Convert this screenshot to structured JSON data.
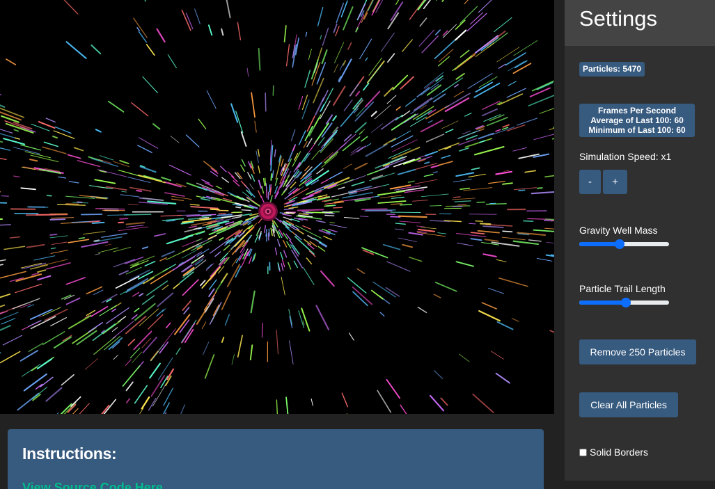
{
  "instructions": {
    "title": "Instructions:",
    "link_label": "View Source Code Here"
  },
  "settings": {
    "title": "Settings",
    "particles_label": "Particles: 5470",
    "fps": {
      "heading": "Frames Per Second",
      "average": "Average of Last 100: 60",
      "minimum": "Minimum of Last 100: 60"
    },
    "simulation_speed_label": "Simulation Speed: x1",
    "speed_decrease_label": "-",
    "speed_increase_label": "+",
    "gravity_well_mass": {
      "label": "Gravity Well Mass",
      "value_fraction": 0.45
    },
    "particle_trail_length": {
      "label": "Particle Trail Length",
      "value_fraction": 0.52
    },
    "remove_particles_label": "Remove 250 Particles",
    "clear_particles_label": "Clear All Particles",
    "solid_borders_label": "Solid Borders",
    "solid_borders_checked": false
  },
  "colors": {
    "page_background": "#222222",
    "sidebar_background": "#303030",
    "sidebar_header_background": "#444444",
    "primary": "#375a7f",
    "success_link": "#00bc8c",
    "slider_accent": "#0d6efd",
    "gravity_well": "#c2185b"
  }
}
